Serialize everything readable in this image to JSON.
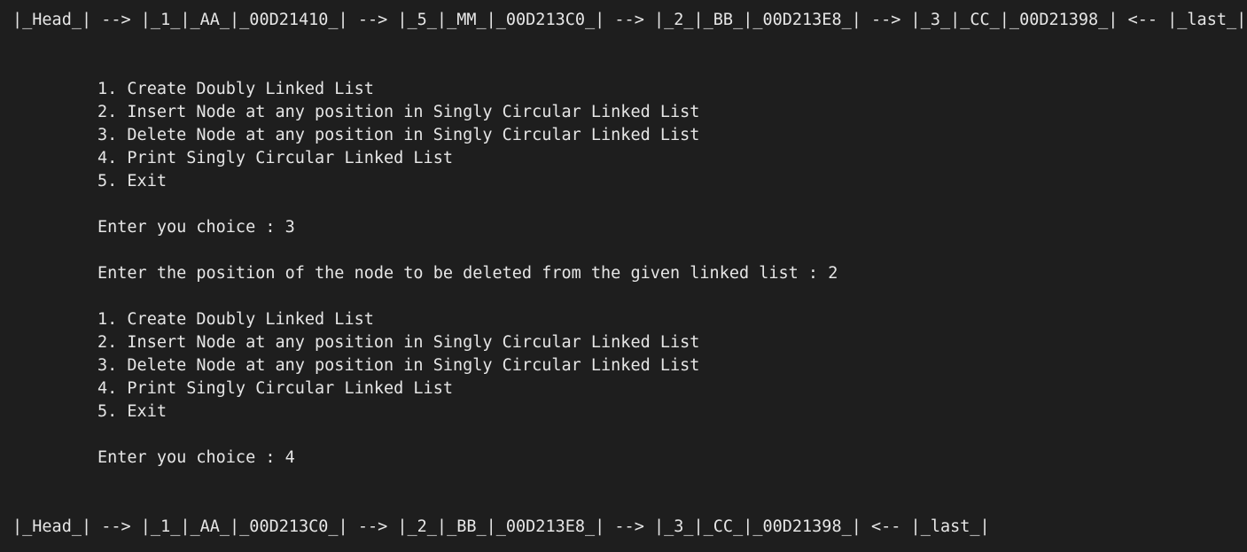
{
  "terminal": {
    "list_before": "|_Head_| --> |_1_|_AA_|_00D21410_| --> |_5_|_MM_|_00D213C0_| --> |_2_|_BB_|_00D213E8_| --> |_3_|_CC_|_00D21398_| <-- |_last_|",
    "menu_first": [
      "1. Create Doubly Linked List",
      "2. Insert Node at any position in Singly Circular Linked List",
      "3. Delete Node at any position in Singly Circular Linked List",
      "4. Print Singly Circular Linked List",
      "5. Exit"
    ],
    "prompt_choice_1": "Enter you choice : 3",
    "prompt_position": "Enter the position of the node to be deleted from the given linked list : 2",
    "menu_second": [
      "1. Create Doubly Linked List",
      "2. Insert Node at any position in Singly Circular Linked List",
      "3. Delete Node at any position in Singly Circular Linked List",
      "4. Print Singly Circular Linked List",
      "5. Exit"
    ],
    "prompt_choice_2": "Enter you choice : 4",
    "list_after": "|_Head_| --> |_1_|_AA_|_00D213C0_| --> |_2_|_BB_|_00D213E8_| --> |_3_|_CC_|_00D21398_| <-- |_last_|"
  },
  "colors": {
    "background": "#1e1e1e",
    "text": "#e6e6e6"
  }
}
